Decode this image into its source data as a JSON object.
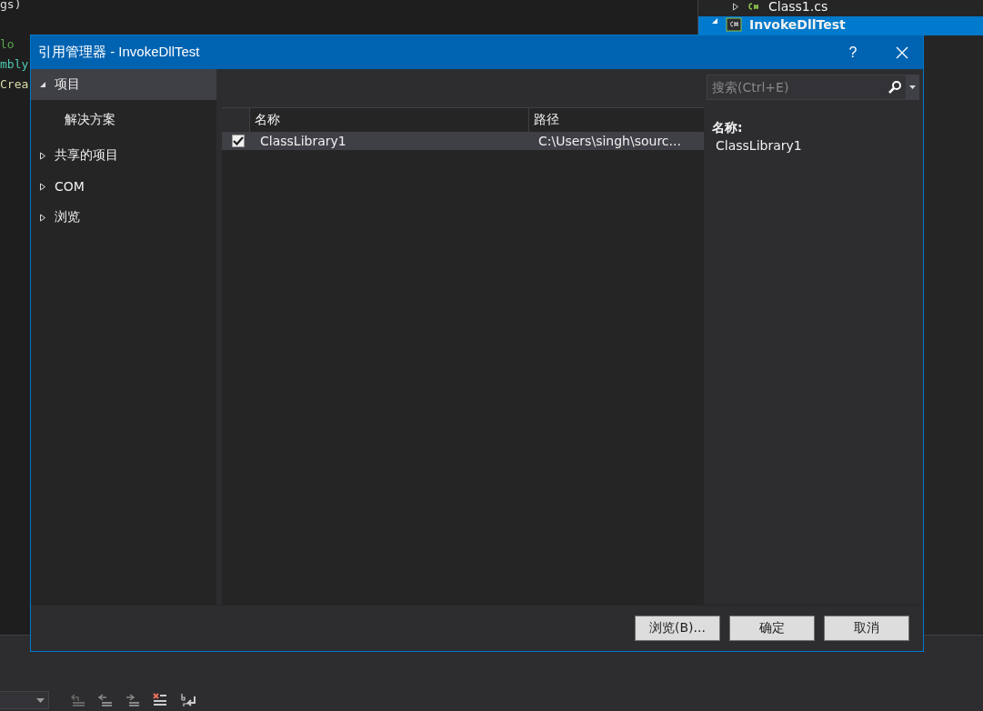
{
  "editor": {
    "lines": [
      {
        "kind": "code",
        "text": "gs)",
        "color": "#dcdcdc"
      },
      {
        "kind": "blank"
      },
      {
        "kind": "code",
        "text": "lo",
        "color": "#57a64a"
      },
      {
        "kind": "code",
        "text": "mbly",
        "color": "#4ec9b0"
      },
      {
        "kind": "code",
        "text": "Crea",
        "color": "#dcdcaa"
      }
    ]
  },
  "solution_explorer": {
    "items": [
      {
        "label": "Class1.cs",
        "kind": "file",
        "expanded": false,
        "selected": false
      },
      {
        "label": "InvokeDllTest",
        "kind": "project",
        "expanded": true,
        "selected": true
      }
    ]
  },
  "dialog": {
    "title": "引用管理器 - InvokeDllTest",
    "help": "?",
    "sidebar": {
      "items": [
        {
          "label": "项目",
          "expanded": true,
          "selected": true,
          "children": [
            {
              "label": "解决方案",
              "selected": false
            }
          ]
        },
        {
          "label": "共享的项目",
          "expanded": false,
          "selected": false
        },
        {
          "label": "COM",
          "expanded": false,
          "selected": false
        },
        {
          "label": "浏览",
          "expanded": false,
          "selected": false
        }
      ]
    },
    "search": {
      "placeholder": "搜索(Ctrl+E)"
    },
    "table": {
      "columns": [
        "名称",
        "路径"
      ],
      "rows": [
        {
          "checked": true,
          "selected": true,
          "name": "ClassLibrary1",
          "path": "C:\\Users\\singh\\sourc..."
        }
      ]
    },
    "details": {
      "label": "名称:",
      "value": "ClassLibrary1"
    },
    "buttons": [
      "浏览(B)...",
      "确定",
      "取消"
    ]
  }
}
